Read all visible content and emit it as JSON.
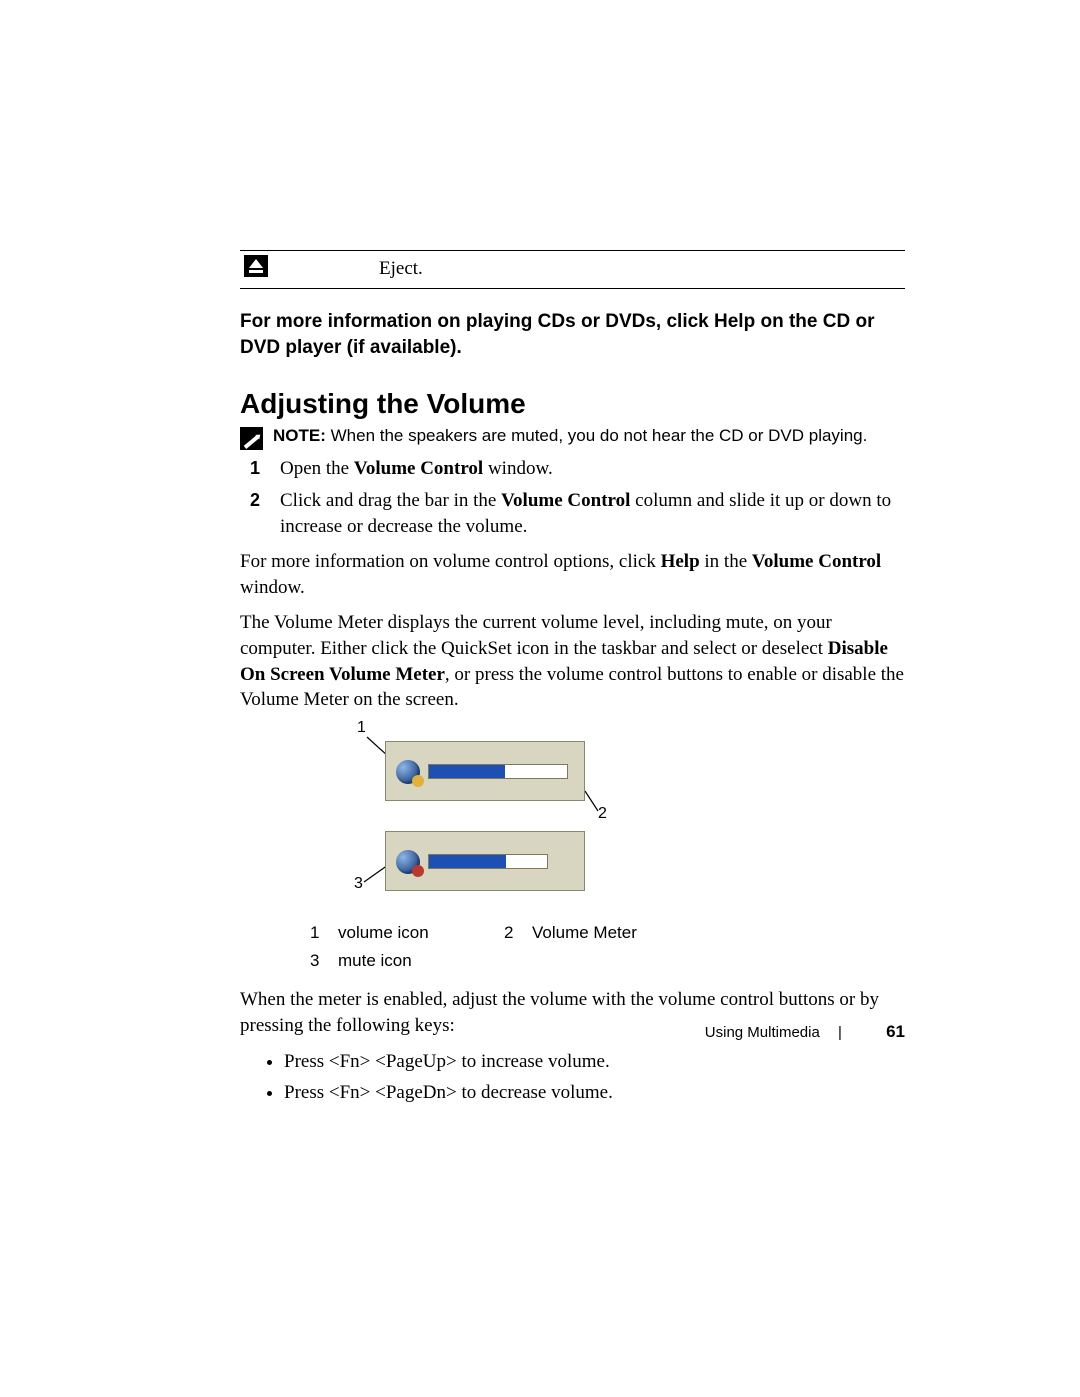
{
  "eject": {
    "label": "Eject."
  },
  "moreinfo_cd": "For more information on playing CDs or DVDs, click Help on the CD or DVD player (if available).",
  "heading": "Adjusting the Volume",
  "note": {
    "prefix": "NOTE:",
    "text": " When the speakers are muted, you do not hear the CD or DVD playing."
  },
  "steps": {
    "s1_a": "Open the ",
    "s1_b": "Volume Control",
    "s1_c": " window.",
    "s2_a": "Click and drag the bar in the ",
    "s2_b": "Volume Control",
    "s2_c": " column and slide it up or down to increase or decrease the volume."
  },
  "para_moreinfo": {
    "a": "For more information on volume control options, click ",
    "b": "Help",
    "c": " in the ",
    "d": "Volume Control",
    "e": " window."
  },
  "para_meter": {
    "a": "The Volume Meter displays the current volume level, including mute, on your computer. Either click the QuickSet icon in the taskbar and select or deselect ",
    "b": "Disable On Screen Volume Meter",
    "c": ", or press the volume control buttons to enable or disable the Volume Meter on the screen."
  },
  "callouts": {
    "c1": "1",
    "c2": "2",
    "c3": "3"
  },
  "legend": {
    "n1": "1",
    "t1": "volume icon",
    "n2": "2",
    "t2": "Volume Meter",
    "n3": "3",
    "t3": "mute icon"
  },
  "para_enabled": "When the meter is enabled, adjust the volume with the volume control buttons or by pressing the following keys:",
  "bullets": {
    "b1": "Press <Fn> <PageUp> to increase volume.",
    "b2": "Press <Fn> <PageDn> to decrease volume."
  },
  "footer": {
    "section": "Using Multimedia",
    "page": "61"
  }
}
